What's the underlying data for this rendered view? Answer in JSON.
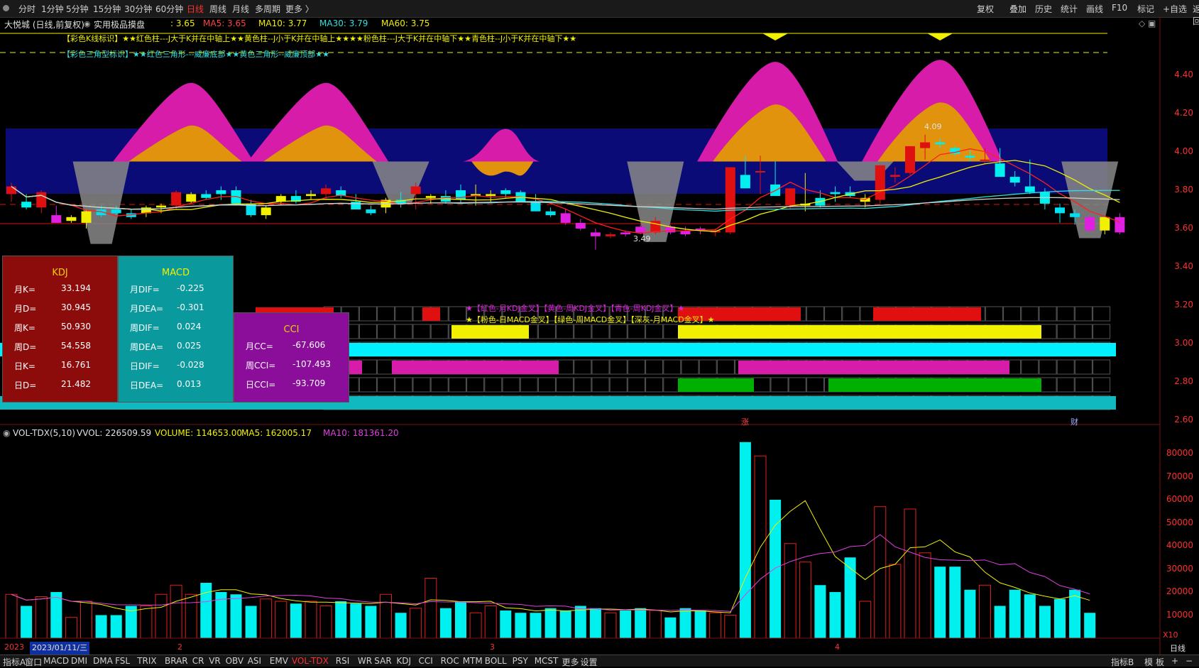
{
  "toolbar": {
    "tabs": [
      "分时",
      "1分钟",
      "5分钟",
      "15分钟",
      "30分钟",
      "60分钟",
      "日线",
      "周线",
      "月线",
      "多周期",
      "更多 〉"
    ],
    "active_tab": "日线",
    "right_tabs": [
      "复权",
      "叠加",
      "历史",
      "统计",
      "画线",
      "F10",
      "标记",
      "+自选",
      "返回"
    ]
  },
  "main": {
    "title": "大悦城 (日线,前复权)",
    "indicator_name": "实用极品摸盘",
    "value_prefix": ": 3.65",
    "ma5": "MA5: 3.65",
    "ma10": "MA10: 3.77",
    "ma30": "MA30: 3.79",
    "ma60": "MA60: 3.75",
    "legend1": "【彩色K线标识】★★红色柱---J大于K并在中轴上★★黄色柱--J小于K并在中轴上★★★★粉色柱---J大于K并在中轴下★★青色柱--J小于K并在中轴下★★",
    "legend2": "【彩色三角型标识】★★红色三角形---威廉底部★★黄色三角形--威廉顶部★★",
    "high_label": "4.09",
    "low_label": "3.49",
    "y_axis": [
      "4.40",
      "4.20",
      "4.00",
      "3.80",
      "3.60",
      "3.40",
      "3.20",
      "3.00",
      "2.80",
      "2.60"
    ],
    "signal_legend1": "★【红色-月KDJ金叉】【黄色-周KDJ金叉】【青色-周KDJ金叉】★",
    "signal_legend2": "★【粉色-日MACD金叉】【绿色-周MACD金叉】【深灰-月MACD金叉】★",
    "marker_zhang": "涨",
    "marker_cai": "财",
    "colors": {
      "pink": "#d61ca8",
      "orange": "#e2930d",
      "navy": "#0b0b78",
      "gray": "#888888",
      "cyan": "#00f0f0",
      "red": "#e01010",
      "yellow": "#f0f000",
      "green": "#00b000"
    }
  },
  "kdj_panel": {
    "title": "KDJ",
    "rows": [
      {
        "k": "月K=",
        "v": "33.194"
      },
      {
        "k": "月D=",
        "v": "30.945"
      },
      {
        "k": "周K=",
        "v": "50.930"
      },
      {
        "k": "周D=",
        "v": "54.558"
      },
      {
        "k": "日K=",
        "v": "16.761"
      },
      {
        "k": "日D=",
        "v": "21.482"
      }
    ]
  },
  "macd_panel": {
    "title": "MACD",
    "rows": [
      {
        "k": "月DIF=",
        "v": "-0.225"
      },
      {
        "k": "月DEA=",
        "v": "-0.301"
      },
      {
        "k": "周DIF=",
        "v": "0.024"
      },
      {
        "k": "周DEA=",
        "v": "0.025"
      },
      {
        "k": "日DIF=",
        "v": "-0.028"
      },
      {
        "k": "日DEA=",
        "v": "0.013"
      }
    ]
  },
  "cci_panel": {
    "title": "CCI",
    "rows": [
      {
        "k": "月CC=",
        "v": "-67.606"
      },
      {
        "k": "周CCI=",
        "v": "-107.493"
      },
      {
        "k": "日CCI=",
        "v": "-93.709"
      }
    ]
  },
  "volume": {
    "header_name": "VOL-TDX(5,10)",
    "vvol": "VVOL: 226509.59",
    "volume": "VOLUME: 114653.00",
    "ma5": "MA5: 162005.17",
    "ma10": "MA10: 181361.20",
    "y_axis": [
      "80000",
      "70000",
      "60000",
      "50000",
      "40000",
      "30000",
      "20000",
      "10000"
    ],
    "unit": "X10",
    "date_label": "2023/01/11/三",
    "year_label": "2023",
    "months": [
      "2",
      "3",
      "4"
    ],
    "period": "日线"
  },
  "bottom": {
    "tabs": [
      "指标A",
      "窗口",
      "MACD",
      "DMI",
      "DMA",
      "FSL",
      "TRIX",
      "BRAR",
      "CR",
      "VR",
      "OBV",
      "ASI",
      "EMV",
      "VOL-TDX",
      "RSI",
      "WR",
      "SAR",
      "KDJ",
      "CCI",
      "ROC",
      "MTM",
      "BOLL",
      "PSY",
      "MCST",
      "更多",
      "设置"
    ],
    "active": "VOL-TDX",
    "right": [
      "指标B",
      "模",
      "板",
      "+",
      "−"
    ]
  },
  "chart_data": {
    "type": "candlestick",
    "candles": [
      [
        3.78,
        3.84,
        3.74,
        3.82
      ],
      [
        3.74,
        3.78,
        3.7,
        3.71
      ],
      [
        3.71,
        3.8,
        3.68,
        3.79
      ],
      [
        3.67,
        3.72,
        3.65,
        3.63
      ],
      [
        3.64,
        3.67,
        3.63,
        3.66
      ],
      [
        3.63,
        3.7,
        3.6,
        3.69
      ],
      [
        3.7,
        3.72,
        3.66,
        3.67
      ],
      [
        3.7,
        3.72,
        3.67,
        3.68
      ],
      [
        3.68,
        3.7,
        3.65,
        3.66
      ],
      [
        3.68,
        3.72,
        3.66,
        3.71
      ],
      [
        3.71,
        3.73,
        3.68,
        3.72
      ],
      [
        3.72,
        3.8,
        3.7,
        3.79
      ],
      [
        3.74,
        3.79,
        3.73,
        3.78
      ],
      [
        3.78,
        3.8,
        3.75,
        3.76
      ],
      [
        3.8,
        3.82,
        3.75,
        3.78
      ],
      [
        3.8,
        3.82,
        3.72,
        3.73
      ],
      [
        3.73,
        3.75,
        3.66,
        3.67
      ],
      [
        3.67,
        3.72,
        3.65,
        3.71
      ],
      [
        3.74,
        3.78,
        3.72,
        3.77
      ],
      [
        3.77,
        3.8,
        3.73,
        3.74
      ],
      [
        3.77,
        3.8,
        3.75,
        3.78
      ],
      [
        3.78,
        3.83,
        3.76,
        3.81
      ],
      [
        3.8,
        3.82,
        3.76,
        3.77
      ],
      [
        3.74,
        3.78,
        3.7,
        3.7
      ],
      [
        3.7,
        3.72,
        3.67,
        3.68
      ],
      [
        3.71,
        3.76,
        3.68,
        3.75
      ],
      [
        3.75,
        3.79,
        3.71,
        3.73
      ],
      [
        3.78,
        3.84,
        3.7,
        3.82
      ],
      [
        3.76,
        3.78,
        3.73,
        3.77
      ],
      [
        3.77,
        3.8,
        3.73,
        3.74
      ],
      [
        3.8,
        3.83,
        3.73,
        3.75
      ],
      [
        3.78,
        3.83,
        3.72,
        3.78
      ],
      [
        3.77,
        3.8,
        3.74,
        3.78
      ],
      [
        3.8,
        3.81,
        3.76,
        3.78
      ],
      [
        3.79,
        3.8,
        3.76,
        3.74
      ],
      [
        3.74,
        3.78,
        3.69,
        3.69
      ],
      [
        3.69,
        3.71,
        3.66,
        3.67
      ],
      [
        3.68,
        3.7,
        3.62,
        3.63
      ],
      [
        3.63,
        3.65,
        3.59,
        3.6
      ],
      [
        3.58,
        3.6,
        3.49,
        3.56
      ],
      [
        3.56,
        3.58,
        3.55,
        3.57
      ],
      [
        3.58,
        3.59,
        3.56,
        3.57
      ],
      [
        3.61,
        3.62,
        3.57,
        3.58
      ],
      [
        3.58,
        3.66,
        3.57,
        3.64
      ],
      [
        3.61,
        3.62,
        3.57,
        3.58
      ],
      [
        3.59,
        3.61,
        3.56,
        3.57
      ],
      [
        3.6,
        3.61,
        3.57,
        3.59
      ],
      [
        3.58,
        3.6,
        3.56,
        3.59
      ],
      [
        3.58,
        3.92,
        3.57,
        3.92
      ],
      [
        3.88,
        3.98,
        3.84,
        3.81
      ],
      [
        3.9,
        3.98,
        3.78,
        3.9
      ],
      [
        3.83,
        3.95,
        3.77,
        3.77
      ],
      [
        3.72,
        3.8,
        3.7,
        3.81
      ],
      [
        3.72,
        3.89,
        3.69,
        3.73
      ],
      [
        3.76,
        3.8,
        3.71,
        3.72
      ],
      [
        3.79,
        3.82,
        3.74,
        3.78
      ],
      [
        3.79,
        3.82,
        3.76,
        3.77
      ],
      [
        3.74,
        3.78,
        3.71,
        3.76
      ],
      [
        3.75,
        3.93,
        3.73,
        3.93
      ],
      [
        3.87,
        3.92,
        3.84,
        3.88
      ],
      [
        3.89,
        4.03,
        3.88,
        4.03
      ],
      [
        4.02,
        4.09,
        3.96,
        4.05
      ],
      [
        4.05,
        4.07,
        4.02,
        4.04
      ],
      [
        4.02,
        4.03,
        3.98,
        3.99
      ],
      [
        3.98,
        4.01,
        3.95,
        3.97
      ],
      [
        3.96,
        4.02,
        3.94,
        3.96
      ],
      [
        3.94,
        4.02,
        3.88,
        3.87
      ],
      [
        3.87,
        3.9,
        3.82,
        3.84
      ],
      [
        3.82,
        3.96,
        3.78,
        3.79
      ],
      [
        3.79,
        3.81,
        3.7,
        3.73
      ],
      [
        3.71,
        3.73,
        3.63,
        3.68
      ],
      [
        3.68,
        3.7,
        3.62,
        3.66
      ],
      [
        3.66,
        3.67,
        3.58,
        3.59
      ],
      [
        3.59,
        3.66,
        3.57,
        3.66
      ],
      [
        3.66,
        3.68,
        3.57,
        3.58
      ]
    ],
    "volumes": [
      19,
      14,
      18,
      20,
      9,
      16,
      10,
      10,
      14,
      14,
      19,
      23,
      19,
      24,
      20,
      19,
      14,
      17,
      16,
      15,
      16,
      14,
      16,
      15,
      14,
      19,
      11,
      13,
      26,
      13,
      16,
      11,
      14,
      12,
      11,
      11,
      13,
      12,
      14,
      13,
      11,
      12,
      13,
      12,
      9,
      13,
      12,
      11,
      10,
      85,
      79,
      60,
      41,
      33,
      23,
      20,
      35,
      16,
      57,
      32,
      56,
      37,
      31,
      31,
      21,
      23,
      14,
      21,
      19,
      14,
      17,
      21,
      11
    ]
  }
}
